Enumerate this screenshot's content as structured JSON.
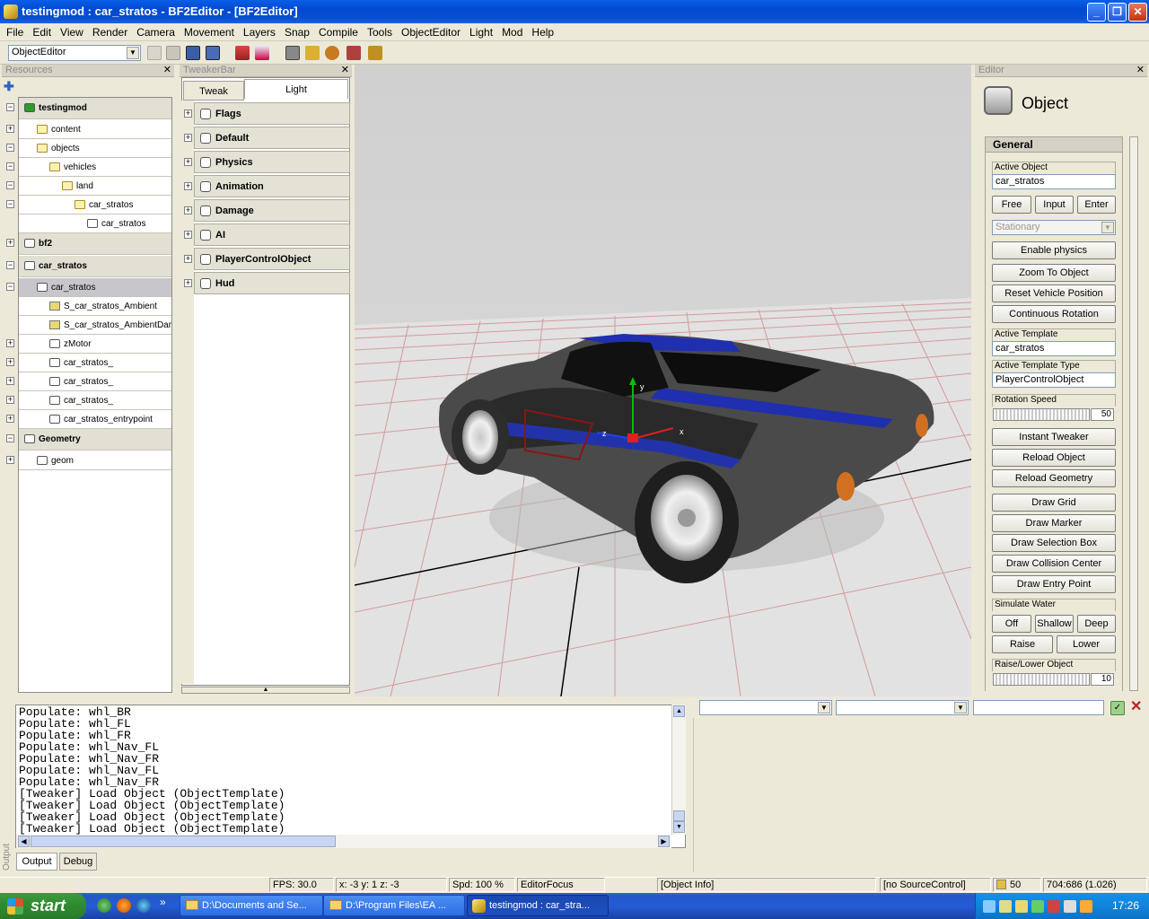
{
  "window": {
    "title": "testingmod : car_stratos - BF2Editor - [BF2Editor]"
  },
  "menu": [
    "File",
    "Edit",
    "View",
    "Render",
    "Camera",
    "Movement",
    "Layers",
    "Snap",
    "Compile",
    "Tools",
    "ObjectEditor",
    "Light",
    "Mod",
    "Help"
  ],
  "toolbar": {
    "editor_mode": "ObjectEditor"
  },
  "resources": {
    "title": "Resources",
    "tree": [
      {
        "label": "testingmod",
        "root": true,
        "exp": "-"
      },
      {
        "label": "content",
        "exp": "+"
      },
      {
        "label": "objects",
        "exp": "-"
      },
      {
        "label": "vehicles",
        "exp": "-"
      },
      {
        "label": "land",
        "exp": "-"
      },
      {
        "label": "car_stratos",
        "exp": "-"
      },
      {
        "label": "car_stratos",
        "exp": ""
      },
      {
        "label": "bf2",
        "root": true,
        "exp": "+"
      },
      {
        "label": "car_stratos",
        "root": true,
        "exp": "-"
      },
      {
        "label": "car_stratos",
        "exp": "-",
        "selected": true
      },
      {
        "label": "S_car_stratos_Ambient",
        "exp": ""
      },
      {
        "label": "S_car_stratos_AmbientDam...",
        "exp": ""
      },
      {
        "label": "zMotor",
        "exp": "+"
      },
      {
        "label": "car_stratos_",
        "exp": "+"
      },
      {
        "label": "car_stratos_",
        "exp": "+"
      },
      {
        "label": "car_stratos_",
        "exp": "+"
      },
      {
        "label": "car_stratos_entrypoint",
        "exp": "+"
      },
      {
        "label": "Geometry",
        "root": true,
        "exp": "-"
      },
      {
        "label": "geom",
        "exp": "+"
      }
    ]
  },
  "tweaker": {
    "title": "TweakerBar",
    "tabs": [
      "Tweak",
      "Light"
    ],
    "sections": [
      "Flags",
      "Default",
      "Physics",
      "Animation",
      "Damage",
      "AI",
      "PlayerControlObject",
      "Hud"
    ]
  },
  "editor": {
    "title": "Editor",
    "heading": "Object",
    "section": "General",
    "active_object_label": "Active Object",
    "active_object": "car_stratos",
    "mode_buttons": [
      "Free",
      "Input",
      "Enter"
    ],
    "stationary": "Stationary",
    "buttons1": [
      "Enable physics",
      "Zoom To Object",
      "Reset Vehicle Position",
      "Continuous Rotation"
    ],
    "active_template_label": "Active Template",
    "active_template": "car_stratos",
    "active_template_type_label": "Active Template Type",
    "active_template_type": "PlayerControlObject",
    "rotation_speed_label": "Rotation Speed",
    "rotation_speed": "50",
    "buttons2": [
      "Instant Tweaker",
      "Reload Object",
      "Reload Geometry"
    ],
    "buttons3": [
      "Draw Grid",
      "Draw Marker",
      "Draw Selection Box",
      "Draw Collision Center",
      "Draw Entry Point"
    ],
    "simulate_water_label": "Simulate Water",
    "water_buttons": [
      "Off",
      "Shallow",
      "Deep"
    ],
    "raise": "Raise",
    "lower": "Lower",
    "raise_lower_label": "Raise/Lower Object",
    "raise_lower_value": "10"
  },
  "output": {
    "lines": [
      "Populate: whl_BR",
      "Populate: whl_FL",
      "Populate: whl_FR",
      "Populate: whl_Nav_FL",
      "Populate: whl_Nav_FR",
      "Populate: whl_Nav_FL",
      "Populate: whl_Nav_FR",
      "[Tweaker] Load Object (ObjectTemplate)",
      "[Tweaker] Load Object (ObjectTemplate)",
      "[Tweaker] Load Object (ObjectTemplate)",
      "[Tweaker] Load Object (ObjectTemplate)"
    ],
    "tabs": [
      "Output",
      "Debug"
    ],
    "side_label": "Output"
  },
  "status": {
    "fps": "FPS: 30.0",
    "coords": "x: -3 y: 1 z: -3",
    "speed": "Spd: 100 %",
    "focus": "EditorFocus",
    "info": "[Object Info]",
    "source": "[no SourceControl]",
    "volume": "50",
    "resolution": "704:686 (1.026)"
  },
  "taskbar": {
    "start": "start",
    "tasks": [
      "D:\\Documents and Se...",
      "D:\\Program Files\\EA ...",
      "testingmod : car_stra..."
    ],
    "clock": "17:26"
  },
  "viewport": {
    "axis_labels": [
      "y",
      "z",
      "x"
    ]
  }
}
